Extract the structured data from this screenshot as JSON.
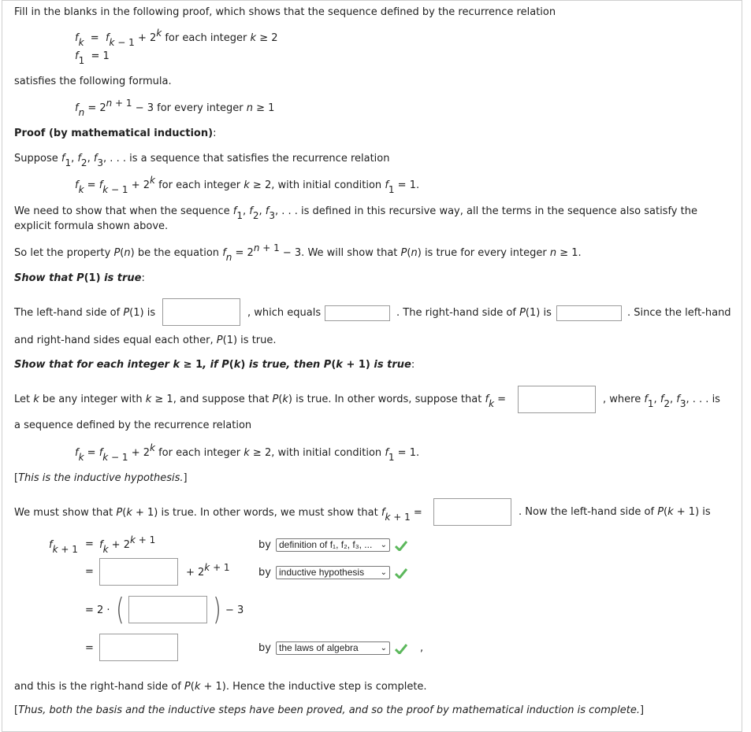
{
  "intro": {
    "line1": "Fill in the blanks in the following proof, which shows that the sequence defined by the recurrence relation",
    "rec1_rest": "for each integer",
    "rec1_cond": "≥ 2",
    "rec2_val": "= 1",
    "satisfies": "satisfies the following formula.",
    "formula_rest": "− 3 for every integer",
    "formula_cond": "≥ 1"
  },
  "proof": {
    "heading": "Proof (by mathematical induction)",
    "suppose": "is a sequence that satisfies the recurrence relation",
    "recurrence_tail": "for each integer k ≥ 2, with initial condition",
    "need_show_1": "is defined in this recursive way, all the terms in the sequence also satisfy the",
    "need_show_2": "explicit formula shown above.",
    "property_a": "So let the property",
    "property_b": "be the equation",
    "property_c": "− 3. We will show that",
    "property_d": "is true for every integer",
    "property_e": "≥ 1."
  },
  "basis": {
    "heading": "Show that P(1) is true",
    "lhs_text": "The left-hand side of P(1) is",
    "which_equals": ", which equals",
    "rhs_text": ". The right-hand side of P(1) is",
    "since": ". Since the left-hand",
    "conclusion": "and right-hand sides equal each other, P(1) is true.",
    "answers": {
      "lhs": "",
      "equals": "",
      "rhs": ""
    }
  },
  "inductive": {
    "heading": "Show that for each integer k ≥ 1, if P(k) is true, then P(k + 1) is true",
    "let_k": "be any integer with",
    "suppose_pk": "is true. In other words, suppose that",
    "where": ", where",
    "is": "is",
    "seq_defined": "a sequence defined by the recurrence relation",
    "hypothesis_note": "This is the inductive hypothesis.",
    "must_show": "We must show that",
    "must_show_b": "is true. In other words, we must show that",
    "now_lhs": ". Now the left-hand side of P(k + 1) is",
    "answers": {
      "fk": "",
      "fk1": "",
      "step2": "",
      "step3": "",
      "step4": ""
    },
    "steps": [
      {
        "by": "by",
        "reason": "definition of f₁, f₂, f₃, ...",
        "status": "correct"
      },
      {
        "by": "by",
        "reason": "inductive hypothesis",
        "status": "correct"
      },
      {
        "by": "by",
        "reason": "the laws of algebra",
        "status": "correct"
      }
    ],
    "rhs_conclusion": "and this is the right-hand side of P(k + 1). Hence the inductive step is complete.",
    "final_note": "Thus, both the basis and the inductive steps have been proved, and so the proof by mathematical induction is complete."
  },
  "colors": {
    "check": "#5cb85c",
    "border": "#9a9a9a"
  }
}
